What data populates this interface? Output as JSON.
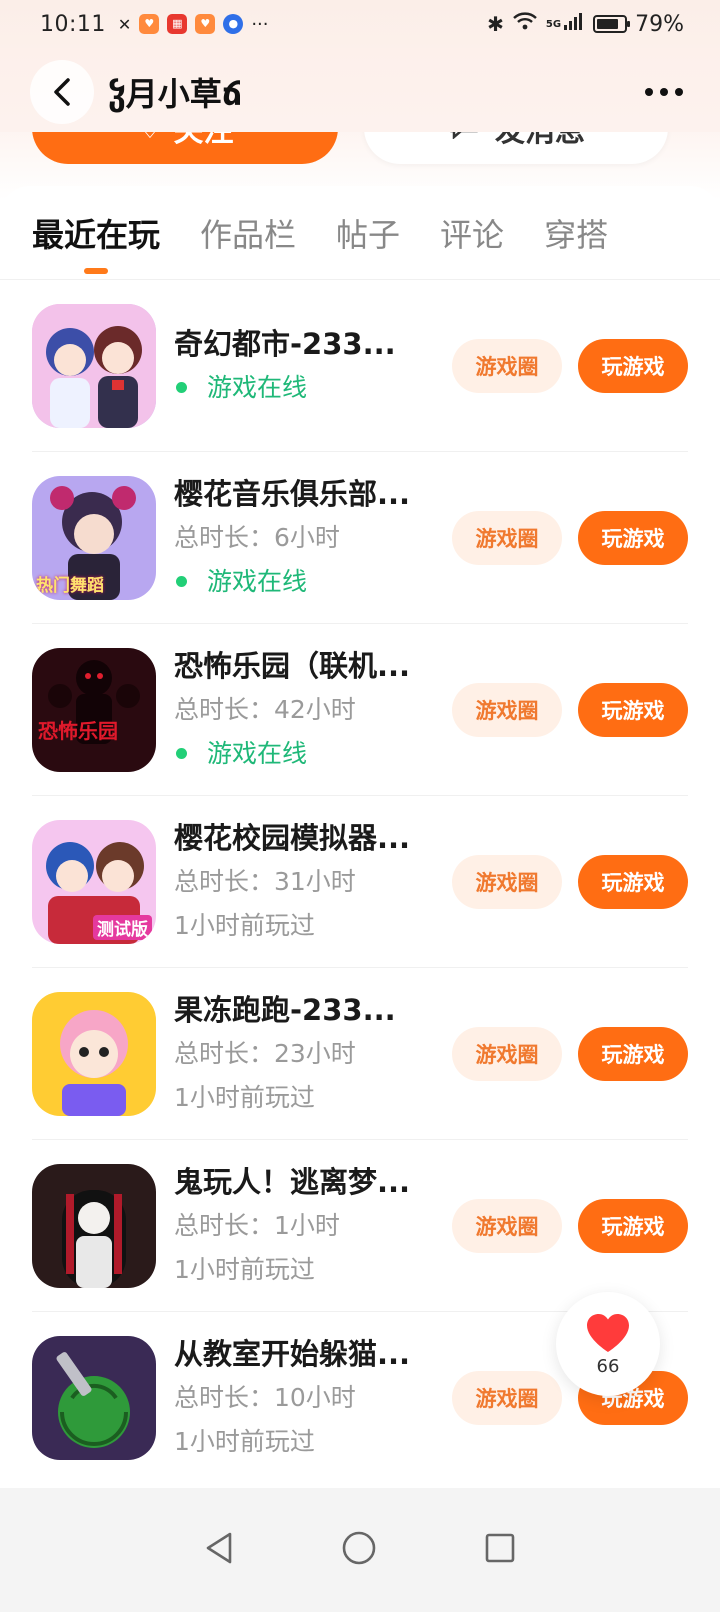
{
  "status_bar": {
    "time": "10:11",
    "network": "5G",
    "battery_percent": "79%",
    "battery_level": 0.79
  },
  "header": {
    "title": "ჴ月小草ճ",
    "back_icon": "chevron-left-icon",
    "more_icon": "more-horizontal-icon"
  },
  "profile_actions": {
    "follow_label": "关注",
    "message_label": "发消息"
  },
  "tabs": [
    {
      "label": "最近在玩",
      "active": true
    },
    {
      "label": "作品栏",
      "active": false
    },
    {
      "label": "帖子",
      "active": false
    },
    {
      "label": "评论",
      "active": false
    },
    {
      "label": "穿搭",
      "active": false
    }
  ],
  "games": [
    {
      "name": "奇幻都市-233...",
      "duration": "",
      "status": "游戏在线",
      "online": true,
      "circle_label": "游戏圈",
      "play_label": "玩游戏"
    },
    {
      "name": "樱花音乐俱乐部...",
      "duration": "总时长：6小时",
      "status": "游戏在线",
      "online": true,
      "circle_label": "游戏圈",
      "play_label": "玩游戏"
    },
    {
      "name": "恐怖乐园（联机...",
      "duration": "总时长：42小时",
      "status": "游戏在线",
      "online": true,
      "circle_label": "游戏圈",
      "play_label": "玩游戏"
    },
    {
      "name": "樱花校园模拟器...",
      "duration": "总时长：31小时",
      "status": "1小时前玩过",
      "online": false,
      "circle_label": "游戏圈",
      "play_label": "玩游戏"
    },
    {
      "name": "果冻跑跑-233...",
      "duration": "总时长：23小时",
      "status": "1小时前玩过",
      "online": false,
      "circle_label": "游戏圈",
      "play_label": "玩游戏"
    },
    {
      "name": "鬼玩人！逃离梦...",
      "duration": "总时长：1小时",
      "status": "1小时前玩过",
      "online": false,
      "circle_label": "游戏圈",
      "play_label": "玩游戏"
    },
    {
      "name": "从教室开始躲猫...",
      "duration": "总时长：10小时",
      "status": "1小时前玩过",
      "online": false,
      "circle_label": "游戏圈",
      "play_label": "玩游戏"
    }
  ],
  "thumbnail_text": {
    "game_2": "热门舞蹈",
    "game_3": "恐怖乐园",
    "game_4": "测试版"
  },
  "like_fab": {
    "count": "66",
    "icon": "heart-icon"
  },
  "colors": {
    "accent": "#ff6d13",
    "online_green": "#1fb878",
    "circle_bg": "#fff0e6"
  }
}
